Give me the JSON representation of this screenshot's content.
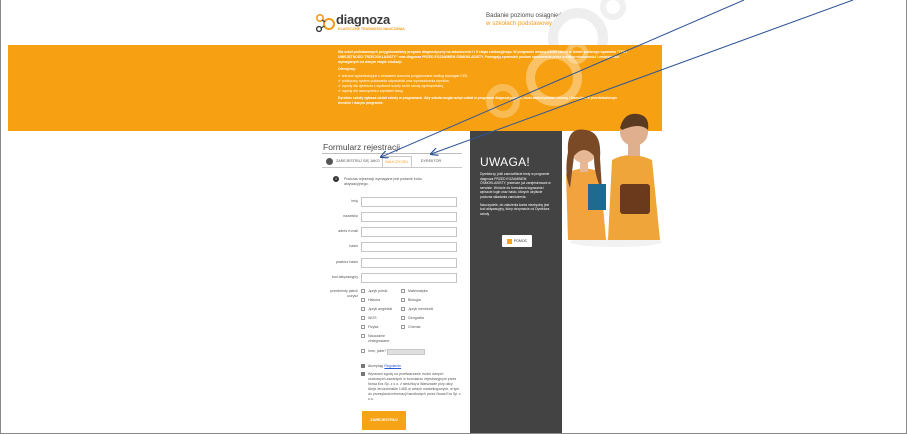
{
  "header": {
    "logo_text": "diagnoza",
    "logo_sub": "KLASYCZNE TRUDNOŚCI NAUCZANIA",
    "tagline_line1": "Badanie poziomu osiągnięć uczniów",
    "tagline_line2": "w szkołach podstawowych"
  },
  "banner": {
    "intro": "Dla szkół podstawowych przygotowaliśmy program diagnostyczny na zakończenie I i II etapu edukacyjnego. W programie wezmą udział szkoły w formie próbnego egzaminu \"TEST UMIEJĘTNOŚCI TRZECIOKLASISTY\" oraz diagnoza PRZED EGZAMINEM ÓSMOKLASISTY. Pomagają sprawdzić poziom opanowania przez uczniów wiadomości i umiejętności wymaganych na danym etapie edukacji.",
    "offer_heading": "Oferujemy:",
    "offer_items": [
      "arkusze egzaminacyjne z zestawem wzorców przygotowane według wymagań CKE,",
      "praktyczny system podawania odpowiedzi oraz wprowadzania wyników,",
      "raporty dla dyrektora z wynikami szkoły na tle szkoły ogólnopolskiej,",
      "raporty dla nauczyciela z wynikami klasy."
    ],
    "closing": "Dyrektor szkoły zgłasza udział szkoły w programach. Aby szkoła mogła wziąć udział w programie diagnostycznym, musi zaakceptować umowę i formularz w przedstawionym terminie i danym programie."
  },
  "form": {
    "title": "Formularz rejestracji",
    "tabs": {
      "user": "ZAREJESTRUJ SIĘ JAKO",
      "teacher": "NAUCZYCIEL",
      "director": "DYREKTOR"
    },
    "info_icon": "!",
    "info": "Podczas rejestracji wymagane jest podanie kodu aktywacyjnego.",
    "fields": [
      {
        "label": "imię",
        "value": ""
      },
      {
        "label": "nazwisko",
        "value": ""
      },
      {
        "label": "adres e-mail",
        "value": ""
      },
      {
        "label": "hasło",
        "value": ""
      },
      {
        "label": "powtórz hasło",
        "value": ""
      },
      {
        "label": "kod aktywacyjny",
        "value": ""
      }
    ],
    "subjects_label_1": "przedmioty jakich",
    "subjects_label_2": "uczysz",
    "subjects": [
      "Język polski",
      "Matematyka",
      "Historia",
      "Biologia",
      "Język angielski",
      "Język niemiecki",
      "WOS",
      "Geografia",
      "Fizyka",
      "Chemia",
      "Nauczanie",
      "Inne, jakie?"
    ],
    "subject_extra": "zintegrowane",
    "accept_prefix": "Akceptuję",
    "accept_link": "Regulamin",
    "consent": "Wyrażam zgodę na przetwarzanie moich danych osobowych zawartych w formularzu rejestracyjnym przez Nowa Era Sp. z o.o. z siedzibą w Warszawie przy ulicy Aleja Jerozolimskie 146D w celach marketingowych, w tym do przesyłania informacji handlowych przez Nowa Era Sp. z o.o.",
    "submit": "ZAREJESTRUJ"
  },
  "sidebar": {
    "title": "UWAGA!",
    "para1": "Dyrektorzy, jeśli zamówiliście testy w programie diagnoza PRZED EGZAMINEM ÓSMOKLASISTY, jesteście już zarejestrowani w serwisie. Wróćcie do formularza logowania i wpiszcie login oraz hasło, których użyliście podczas składania zamówienia.",
    "para2": "Nauczyciele, do założenia konta niezbędny jest kod aktywacyjny, który otrzymacie od Dyrektora szkoły.",
    "help_button": "POMOC"
  },
  "colors": {
    "orange": "#f7a112",
    "dark_panel": "#434343",
    "arrow": "#2f5597"
  }
}
